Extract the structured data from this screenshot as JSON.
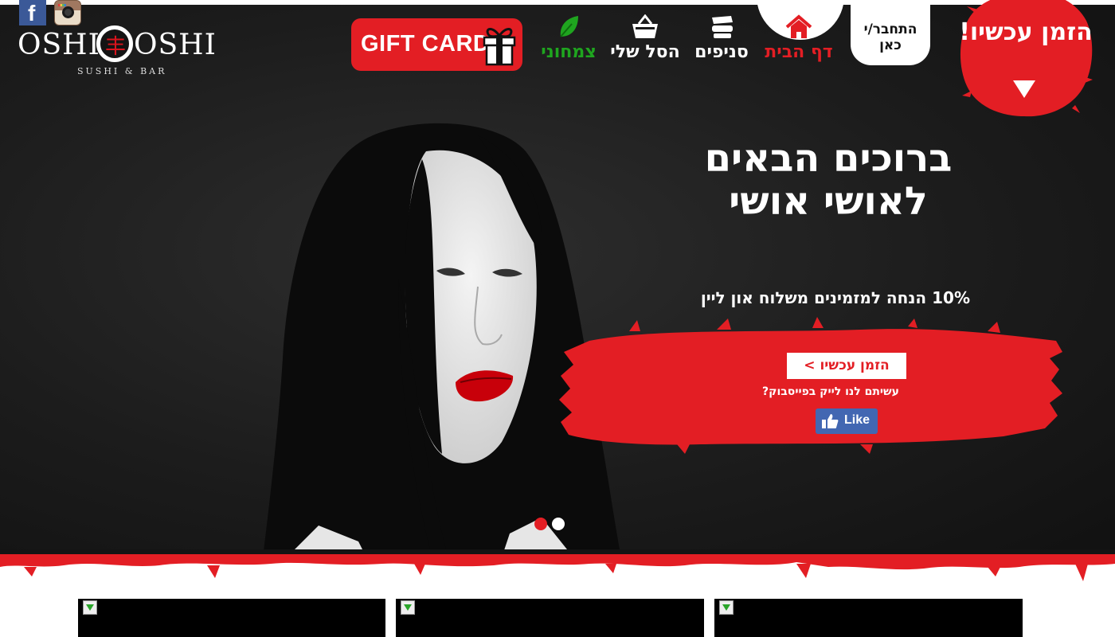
{
  "social": {
    "facebook_icon": "facebook-icon",
    "instagram_icon": "instagram-icon"
  },
  "logo": {
    "word_left": "OSHI",
    "word_right": "OSHI",
    "seal_char": "丰",
    "tagline": "SUSHI & BAR"
  },
  "gift_card": {
    "label": "GIFT CARD",
    "icon": "gift-box-icon"
  },
  "nav": {
    "items": [
      {
        "label": "צמחוני",
        "icon": "leaf-icon",
        "color": "#1fa51f"
      },
      {
        "label": "הסל שלי",
        "icon": "basket-icon",
        "color": "#ffffff"
      },
      {
        "label": "סניפים",
        "icon": "sushi-icon",
        "color": "#ffffff"
      },
      {
        "label": "דף הבית",
        "icon": "home-icon",
        "color": "#e31e24"
      }
    ]
  },
  "login": {
    "label": "התחבר/י כאן"
  },
  "order_badge": {
    "label": "הזמן עכשיו!",
    "icon": "triangle-down-icon"
  },
  "hero": {
    "headline_line1": "ברוכים הבאים",
    "headline_line2": "לאושי אושי",
    "discount": "10% הנחה למזמינים משלוח און ליין",
    "order_button": "הזמן עכשיו >",
    "fb_question": "עשיתם לנו לייק בפייסבוק?",
    "like_button": "Like",
    "carousel": {
      "slides": 2,
      "active": 1
    }
  },
  "colors": {
    "brand_red": "#e31e24",
    "dark_bg": "#1c1c1c",
    "veg_green": "#1fa51f",
    "facebook_blue": "#4267b2"
  }
}
